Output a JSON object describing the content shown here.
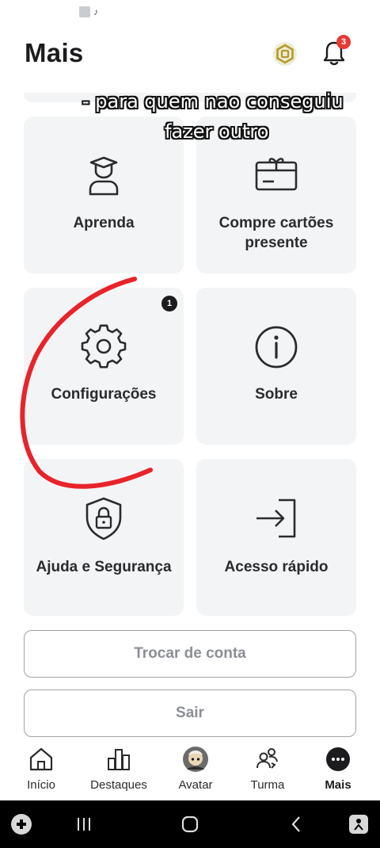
{
  "header": {
    "title": "Mais",
    "notification_count": "3"
  },
  "overlay": {
    "line1": "- para quem nao conseguiu",
    "line2": "fazer outro"
  },
  "menu": {
    "items": [
      {
        "label": "Aprenda",
        "icon": "learn-icon"
      },
      {
        "label": "Compre cartões presente",
        "icon": "gift-card-icon"
      },
      {
        "label": "Configurações",
        "icon": "gear-icon",
        "badge": "1"
      },
      {
        "label": "Sobre",
        "icon": "info-icon"
      },
      {
        "label": "Ajuda e Segurança",
        "icon": "shield-lock-icon"
      },
      {
        "label": "Acesso rápido",
        "icon": "sign-in-icon"
      }
    ]
  },
  "actions": {
    "switch_account": "Trocar de conta",
    "logout": "Sair"
  },
  "tabbar": {
    "tabs": [
      {
        "label": "Início",
        "icon": "home-icon"
      },
      {
        "label": "Destaques",
        "icon": "charts-icon"
      },
      {
        "label": "Avatar",
        "icon": "avatar-icon"
      },
      {
        "label": "Turma",
        "icon": "friends-icon"
      },
      {
        "label": "Mais",
        "icon": "more-icon",
        "active": true
      }
    ]
  },
  "colors": {
    "card_bg": "#f2f4f5",
    "badge_red": "#e53935",
    "annotation_red": "#e8232a",
    "border_gray": "#9ea3a8"
  }
}
